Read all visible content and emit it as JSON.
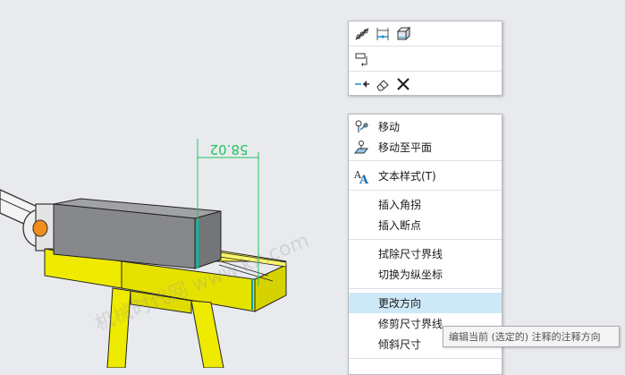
{
  "colors": {
    "background": "#e8eaee",
    "part_yellow": "#f1ee00",
    "block_gray": "#8b8d90",
    "dimension_green": "#22c55e",
    "highlight": "#cde8f6"
  },
  "viewport": {
    "dimension_value": "58.02",
    "watermark": "机械时代网 www.kx.com"
  },
  "mini_toolbar": {
    "row1": [
      "chain-dimension-icon",
      "dimension-spacing-icon",
      "3d-annotation-icon"
    ],
    "row2": [
      "note-leader-icon"
    ],
    "row3": [
      "arrow-flip-icon",
      "eraser-icon",
      "delete-icon"
    ]
  },
  "context_menu": {
    "items": [
      {
        "label": "移动",
        "icon": "move-icon"
      },
      {
        "label": "移动至平面",
        "icon": "move-to-plane-icon"
      },
      {
        "label": "文本样式(T)",
        "icon": "text-style-icon"
      },
      {
        "label": "插入角拐",
        "icon": ""
      },
      {
        "label": "插入断点",
        "icon": ""
      },
      {
        "label": "拭除尺寸界线",
        "icon": ""
      },
      {
        "label": "切换为纵坐标",
        "icon": ""
      },
      {
        "label": "更改方向",
        "icon": "",
        "highlighted": true
      },
      {
        "label": "修剪尺寸界线",
        "icon": ""
      },
      {
        "label": "倾斜尺寸",
        "icon": ""
      }
    ]
  },
  "tooltip": {
    "text": "编辑当前 (选定的) 注释的注释方向"
  }
}
